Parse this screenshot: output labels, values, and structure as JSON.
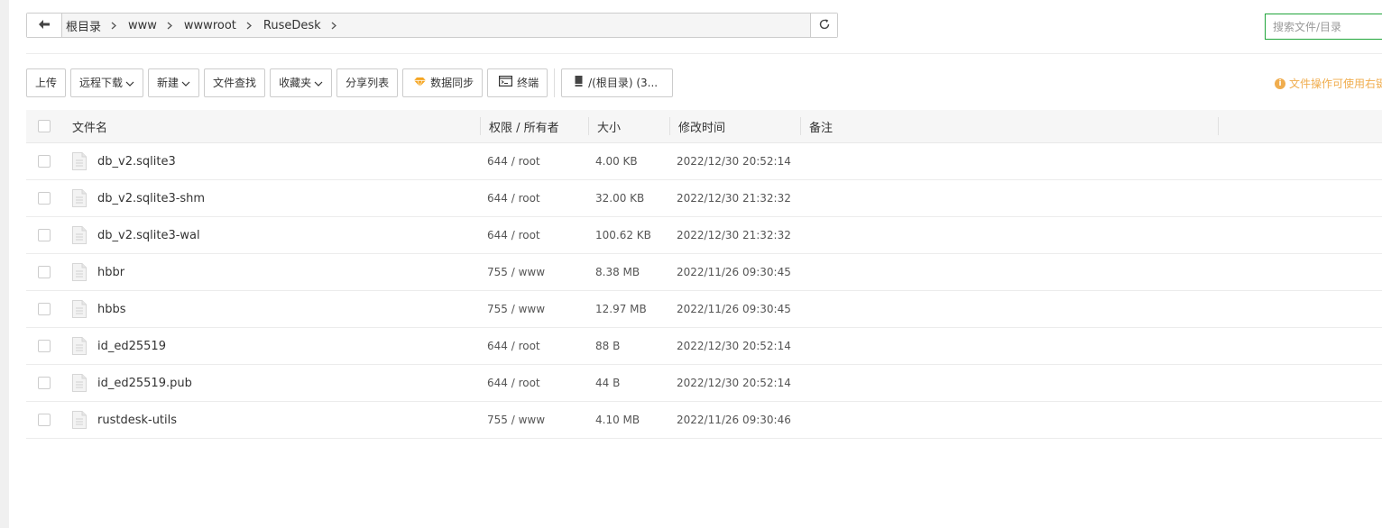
{
  "pathbar": {
    "crumbs": [
      "根目录",
      "www",
      "wwwroot",
      "RuseDesk"
    ]
  },
  "search": {
    "placeholder": "搜索文件/目录"
  },
  "toolbar": {
    "upload": "上传",
    "remote_download": "远程下载",
    "new": "新建",
    "find": "文件查找",
    "favorites": "收藏夹",
    "share_list": "分享列表",
    "data_sync": "数据同步",
    "terminal": "终端",
    "disk": "/(根目录) (3..."
  },
  "tip": "文件操作可使用右键",
  "table": {
    "headers": {
      "name": "文件名",
      "perm": "权限 / 所有者",
      "size": "大小",
      "mtime": "修改时间",
      "note": "备注"
    },
    "rows": [
      {
        "name": "db_v2.sqlite3",
        "perm": "644 / root",
        "size": "4.00 KB",
        "mtime": "2022/12/30 20:52:14"
      },
      {
        "name": "db_v2.sqlite3-shm",
        "perm": "644 / root",
        "size": "32.00 KB",
        "mtime": "2022/12/30 21:32:32"
      },
      {
        "name": "db_v2.sqlite3-wal",
        "perm": "644 / root",
        "size": "100.62 KB",
        "mtime": "2022/12/30 21:32:32"
      },
      {
        "name": "hbbr",
        "perm": "755 / www",
        "size": "8.38 MB",
        "mtime": "2022/11/26 09:30:45"
      },
      {
        "name": "hbbs",
        "perm": "755 / www",
        "size": "12.97 MB",
        "mtime": "2022/11/26 09:30:45"
      },
      {
        "name": "id_ed25519",
        "perm": "644 / root",
        "size": "88 B",
        "mtime": "2022/12/30 20:52:14"
      },
      {
        "name": "id_ed25519.pub",
        "perm": "644 / root",
        "size": "44 B",
        "mtime": "2022/12/30 20:52:14"
      },
      {
        "name": "rustdesk-utils",
        "perm": "755 / www",
        "size": "4.10 MB",
        "mtime": "2022/11/26 09:30:46"
      }
    ]
  }
}
